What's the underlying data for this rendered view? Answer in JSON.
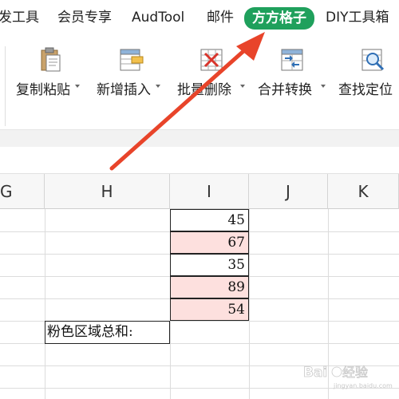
{
  "ribbon_tabs": [
    {
      "label": "发工具"
    },
    {
      "label": "会员专享"
    },
    {
      "label": "AudTool"
    },
    {
      "label": "邮件"
    },
    {
      "label": "方方格子",
      "active": true
    },
    {
      "label": "DIY工具箱"
    }
  ],
  "tools": [
    {
      "label": "复制粘贴",
      "icon": "clipboard-paste-icon"
    },
    {
      "label": "新增插入",
      "icon": "insert-row-icon"
    },
    {
      "label": "批量删除",
      "icon": "batch-delete-icon"
    },
    {
      "label": "合并转换",
      "icon": "merge-convert-icon"
    },
    {
      "label": "查找定位",
      "icon": "find-locate-icon"
    }
  ],
  "columns": [
    "G",
    "H",
    "I",
    "J",
    "K"
  ],
  "cells_i": [
    {
      "value": "45",
      "highlight": false
    },
    {
      "value": "67",
      "highlight": true
    },
    {
      "value": "35",
      "highlight": false
    },
    {
      "value": "89",
      "highlight": true
    },
    {
      "value": "54",
      "highlight": true
    }
  ],
  "sum_label": "粉色区域总和:",
  "colors": {
    "accent": "#1fa05c",
    "pink_fill": "#fde0de",
    "arrow": "#e8442a"
  },
  "watermark": {
    "text": "Baidu经验",
    "sub": "jingyan.baidu.com"
  }
}
